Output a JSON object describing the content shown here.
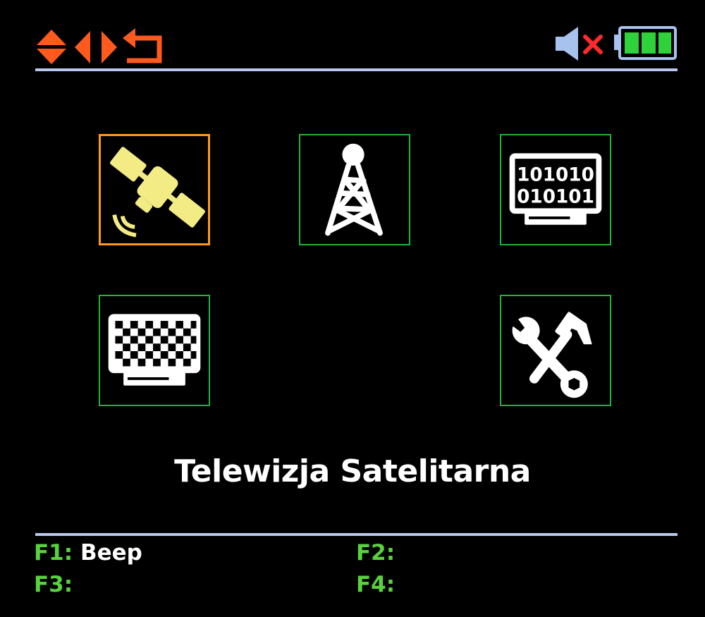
{
  "header": {
    "nav_icons": [
      "updown-arrows-icon",
      "left-arrow-icon",
      "right-arrow-icon",
      "back-arrow-icon"
    ],
    "status_icons": [
      "speaker-muted-icon",
      "battery-full-icon"
    ]
  },
  "menu": {
    "tiles": [
      {
        "icon": "satellite-icon",
        "selected": true
      },
      {
        "icon": "transmitter-tower-icon",
        "selected": false
      },
      {
        "icon": "binary-data-monitor-icon",
        "selected": false
      },
      {
        "icon": "test-pattern-monitor-icon",
        "selected": false
      },
      {
        "icon": "tools-icon",
        "selected": false
      }
    ],
    "selected_title": "Telewizja Satelitarna"
  },
  "function_keys": [
    {
      "key": "F1:",
      "value": "Beep"
    },
    {
      "key": "F2:",
      "value": ""
    },
    {
      "key": "F3:",
      "value": ""
    },
    {
      "key": "F4:",
      "value": ""
    }
  ],
  "colors": {
    "background": "#000000",
    "selected_border": "#ff9a1c",
    "tile_border": "#22b33a",
    "nav_arrows": "#ff5a1e",
    "separator": "#b8c8ee",
    "fkey_label": "#58d33c",
    "battery": "#2fd23a",
    "mute_x": "#ff2a2a"
  }
}
